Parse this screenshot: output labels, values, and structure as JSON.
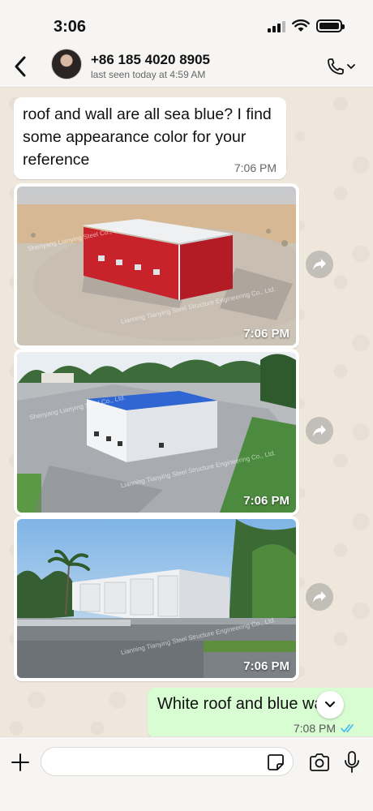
{
  "status_bar": {
    "time": "3:06"
  },
  "header": {
    "contact_name": "+86 185 4020 8905",
    "last_seen": "last seen today at 4:59 AM"
  },
  "messages": [
    {
      "type": "text",
      "direction": "incoming",
      "text": "roof and wall are all sea blue? I find some appearance color for your reference",
      "time": "7:06 PM"
    },
    {
      "type": "image",
      "direction": "incoming",
      "scene": "red-building-desert",
      "time": "7:06 PM",
      "watermark_top": "Shenyang Lianying Steel Co., Ltd.",
      "watermark_bottom": "Lianning Tianying Steel Structure Engineering Co., Ltd."
    },
    {
      "type": "image",
      "direction": "incoming",
      "scene": "white-building-blue-roof",
      "time": "7:06 PM",
      "watermark_top": "Shenyang Lianying Steel Co., Ltd.",
      "watermark_bottom": "Lianning Tianying Steel Structure Engineering Co., Ltd."
    },
    {
      "type": "image",
      "direction": "incoming",
      "scene": "white-garage-palms",
      "time": "7:06 PM",
      "watermark_bottom": "Lianning Tianying Steel Structure Engineering Co., Ltd."
    },
    {
      "type": "text",
      "direction": "outgoing",
      "text": "White roof and blue wa",
      "time": "7:08 PM",
      "status": "read"
    }
  ],
  "input": {
    "placeholder": ""
  },
  "colors": {
    "outgoing_bubble": "#d9fdd3",
    "read_ticks": "#53bdeb",
    "incoming_bubble": "#ffffff"
  }
}
